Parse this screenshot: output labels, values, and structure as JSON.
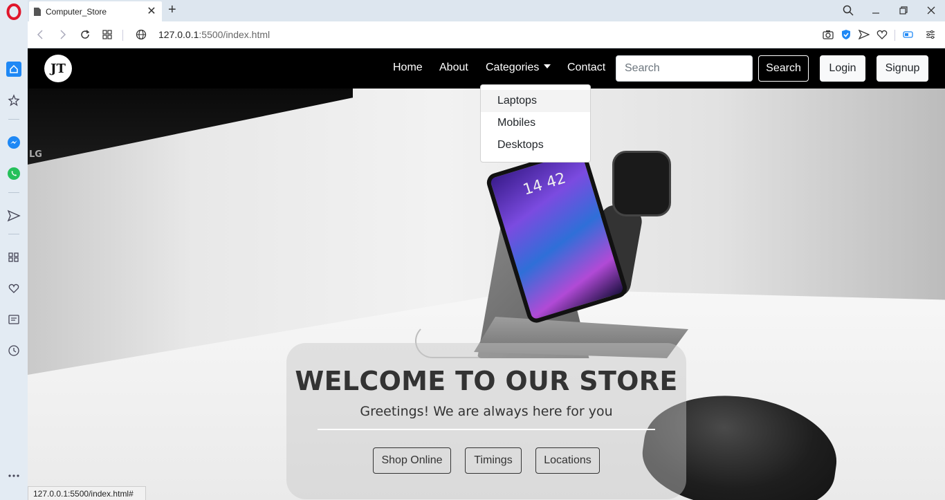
{
  "browser": {
    "tab": {
      "title": "Computer_Store",
      "icon": "document-icon"
    },
    "url": {
      "host": "127.0.0.1",
      "rest": ":5500/index.html"
    },
    "status_url": "127.0.0.1:5500/index.html#",
    "sidebar_icons": [
      "opera-logo-icon",
      "home-icon",
      "bookmark-star-icon",
      "messenger-icon",
      "whatsapp-icon",
      "send-icon",
      "apps-grid-icon",
      "heart-icon",
      "news-icon",
      "history-clock-icon",
      "more-icon"
    ],
    "accent_color": "#1e88f5"
  },
  "navbar": {
    "brand": "JT",
    "links": {
      "home": "Home",
      "about": "About",
      "categories": "Categories",
      "contact": "Contact"
    },
    "search": {
      "placeholder": "Search",
      "button": "Search"
    },
    "login": "Login",
    "signup": "Signup"
  },
  "dropdown": {
    "items": [
      "Laptops",
      "Mobiles",
      "Desktops"
    ]
  },
  "hero": {
    "title": "WELCOME TO OUR STORE",
    "subtitle": "Greetings! We are always here for you",
    "buttons": {
      "shop": "Shop Online",
      "timings": "Timings",
      "locations": "Locations"
    }
  },
  "scene": {
    "phone_time": "14 42",
    "monitor_brand": "LG"
  }
}
